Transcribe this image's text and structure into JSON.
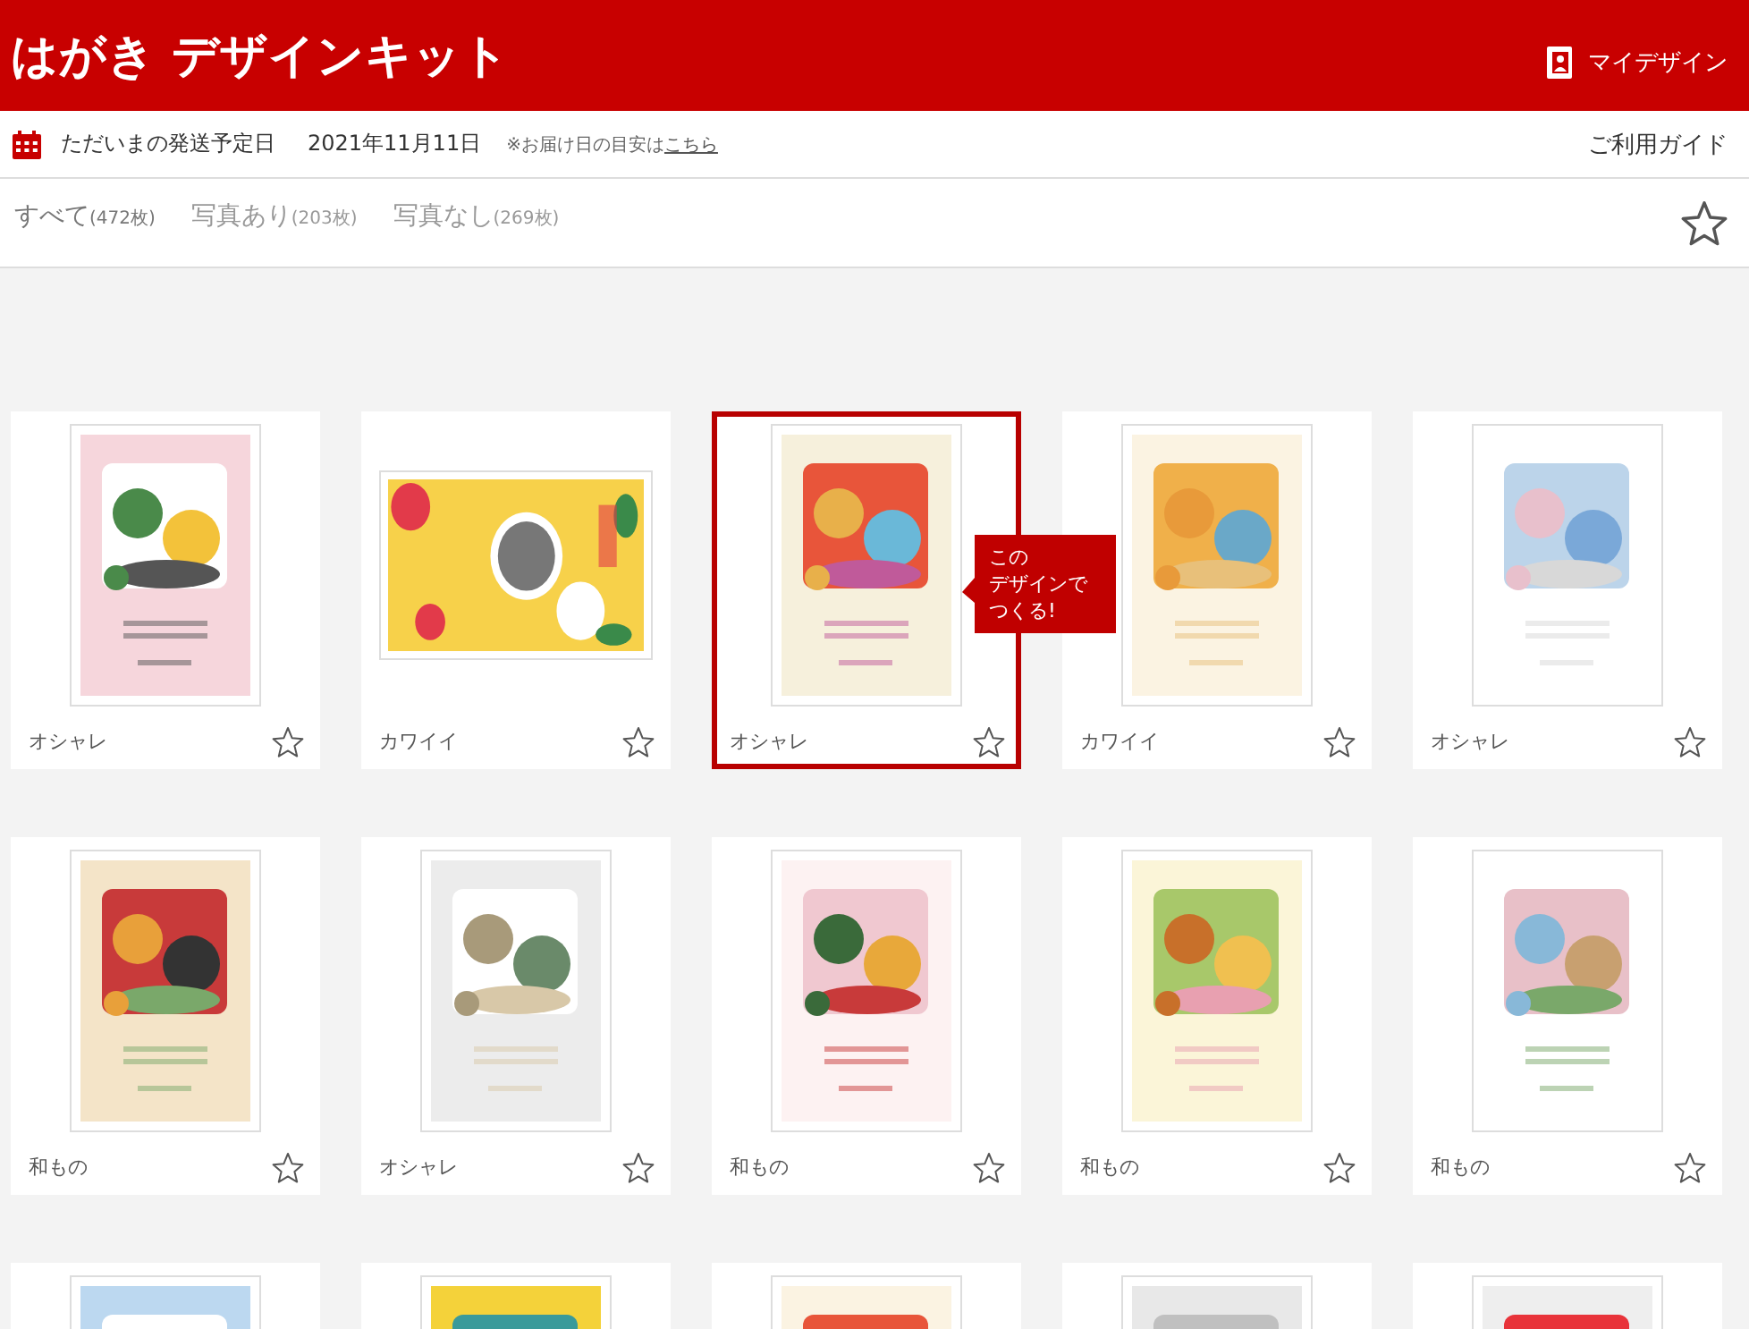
{
  "header": {
    "title": "はがき デザインキット",
    "my_design": "マイデザイン"
  },
  "info_bar": {
    "label": "ただいまの発送予定日",
    "date": "2021年11月11日",
    "note": "※お届け日の目安は",
    "note_link": "こちら",
    "guide": "ご利用ガイド"
  },
  "tabs": [
    {
      "label": "すべて",
      "count": "(472枚)",
      "selected": true
    },
    {
      "label": "写真あり",
      "count": "(203枚)",
      "selected": false
    },
    {
      "label": "写真なし",
      "count": "(269枚)",
      "selected": false
    }
  ],
  "favorites_filter": {
    "on": false
  },
  "cards": [
    {
      "kind": "portrait",
      "label": "オシャレ",
      "favorite": false,
      "selected": false
    },
    {
      "kind": "landscape",
      "label": "カワイイ",
      "favorite": false,
      "selected": false
    },
    {
      "kind": "portrait",
      "label": "オシャレ",
      "favorite": false,
      "selected": true,
      "tooltip_lines": [
        "この",
        "デザインで",
        "つくる!"
      ]
    },
    {
      "kind": "portrait",
      "label": "カワイイ",
      "favorite": false,
      "selected": false
    },
    {
      "kind": "portrait",
      "label": "オシャレ",
      "favorite": false,
      "selected": false
    },
    {
      "kind": "portrait",
      "label": "和もの",
      "favorite": false,
      "selected": false
    },
    {
      "kind": "portrait",
      "label": "オシャレ",
      "favorite": false,
      "selected": false
    },
    {
      "kind": "portrait",
      "label": "和もの",
      "favorite": false,
      "selected": false
    },
    {
      "kind": "portrait",
      "label": "和もの",
      "favorite": false,
      "selected": false
    },
    {
      "kind": "portrait",
      "label": "和もの",
      "favorite": false,
      "selected": false
    },
    {
      "kind": "portrait",
      "selected": false
    },
    {
      "kind": "portrait",
      "selected": false
    },
    {
      "kind": "portrait",
      "selected": false
    },
    {
      "kind": "portrait",
      "selected": false
    },
    {
      "kind": "portrait",
      "selected": false
    }
  ]
}
